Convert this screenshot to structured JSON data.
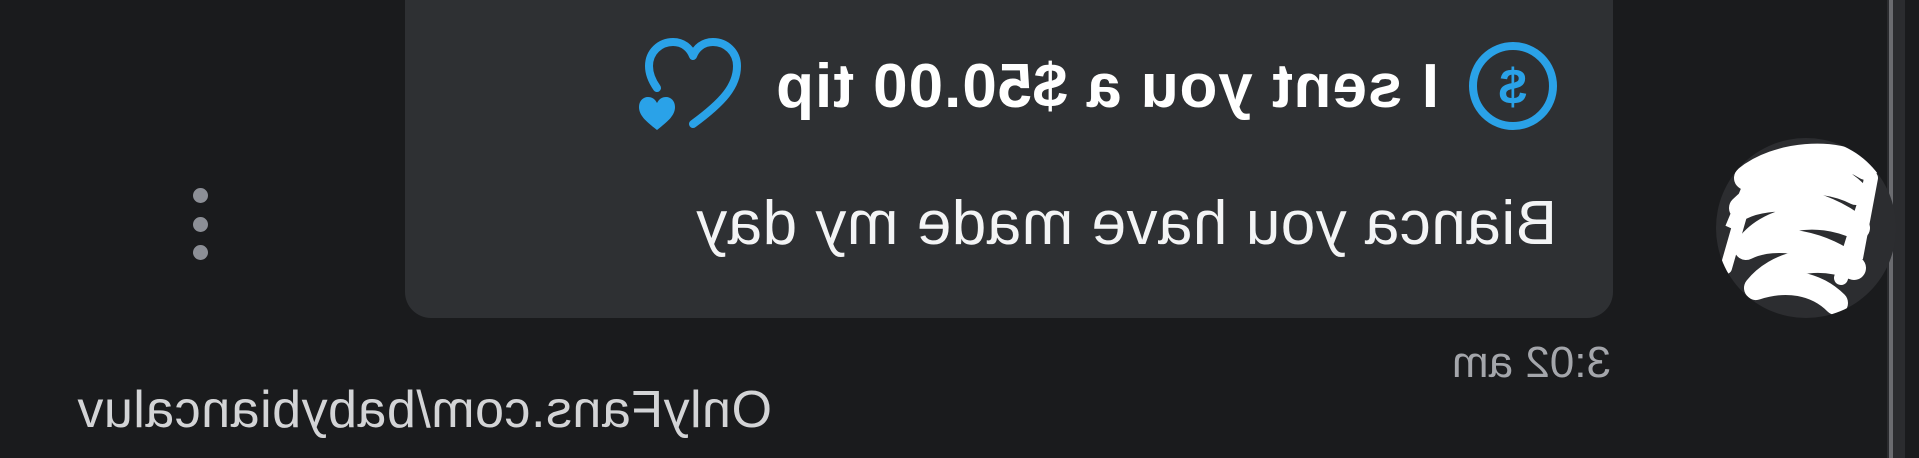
{
  "tip": {
    "label": "I sent you a $50.00 tip",
    "icon": "dollar-coin-icon",
    "heart_icon": "heart-with-small-heart-icon",
    "accent_color": "#2aa2e8"
  },
  "message": {
    "text": "Bianca you have made my day",
    "timestamp": "3:02 am"
  },
  "actions": {
    "more_icon": "vertical-ellipsis-icon"
  },
  "watermark": {
    "text": "OnlyFans.com/babybiancaluv"
  },
  "colors": {
    "background": "#1a1b1d",
    "bubble": "#2e3033",
    "text_primary": "#ffffff",
    "text_secondary": "#a4a6ab"
  }
}
